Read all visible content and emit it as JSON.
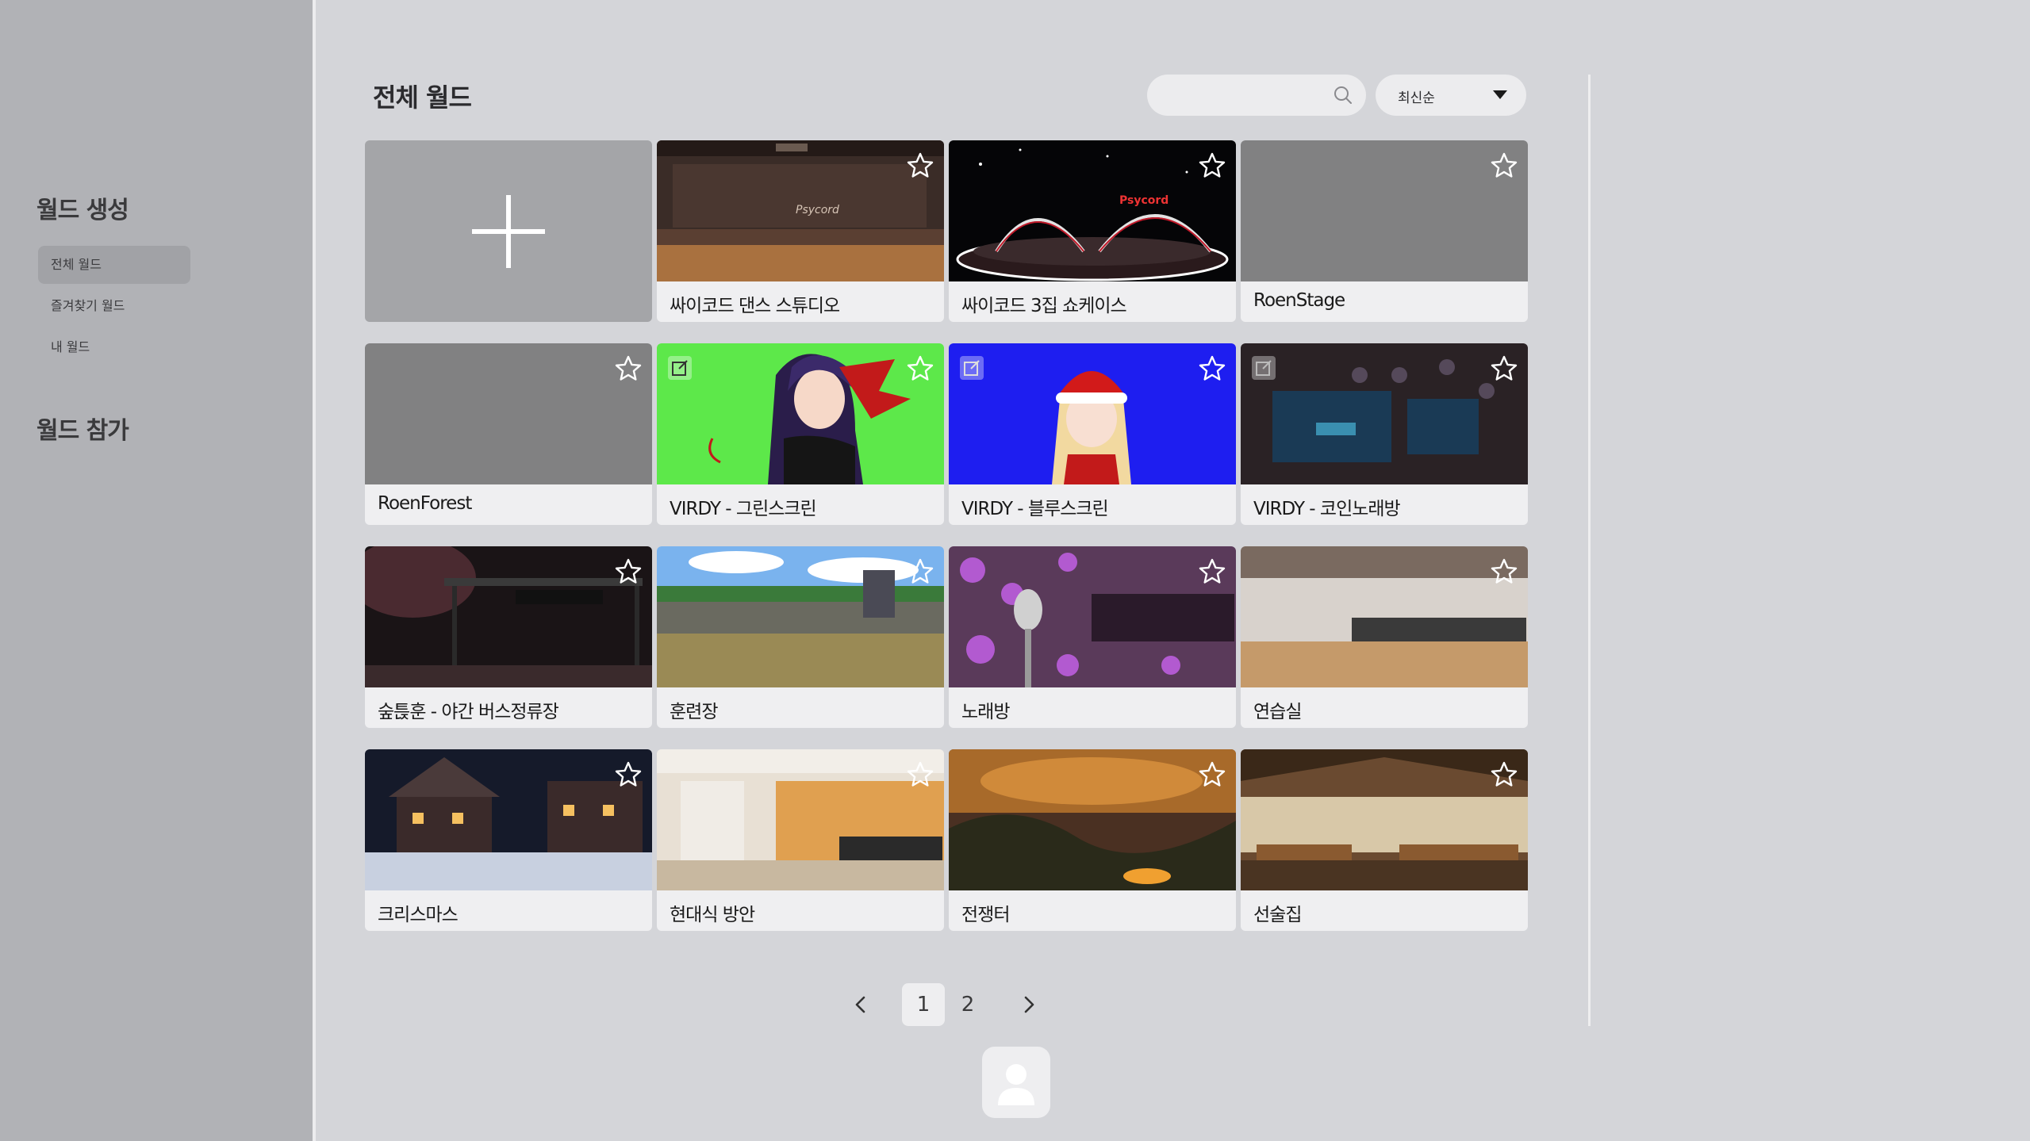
{
  "sidebar": {
    "create_title": "월드 생성",
    "items": [
      {
        "label": "전체 월드"
      },
      {
        "label": "즐겨찾기 월드"
      },
      {
        "label": "내 월드"
      }
    ],
    "join_title": "월드 참가"
  },
  "main": {
    "title": "전체 월드",
    "search": {
      "placeholder": "",
      "value": ""
    },
    "sort": {
      "selected": "최신순"
    },
    "cards": [
      {
        "label": "싸이코드 댄스 스튜디오"
      },
      {
        "label": "싸이코드 3집 쇼케이스"
      },
      {
        "label": "RoenStage"
      },
      {
        "label": "RoenForest"
      },
      {
        "label": "VIRDY - 그린스크린"
      },
      {
        "label": "VIRDY - 블루스크린"
      },
      {
        "label": "VIRDY - 코인노래방"
      },
      {
        "label": "숲튽훈 - 야간 버스정류장"
      },
      {
        "label": "훈련장"
      },
      {
        "label": "노래방"
      },
      {
        "label": "연습실"
      },
      {
        "label": "크리스마스"
      },
      {
        "label": "현대식 방안"
      },
      {
        "label": "전쟁터"
      },
      {
        "label": "선술집"
      }
    ],
    "pagination": {
      "pages": [
        "1",
        "2"
      ],
      "current": "1"
    }
  },
  "colors": {
    "background": "#d4d5d9",
    "sidebar": "#b1b2b6",
    "card": "#efeff1",
    "green_screen": "#5de84a",
    "blue_screen": "#1e1ef0"
  },
  "icons": [
    "search-icon",
    "chevron-down-icon",
    "plus-icon",
    "star-icon",
    "edit-icon",
    "chevron-left-icon",
    "chevron-right-icon",
    "user-icon"
  ]
}
